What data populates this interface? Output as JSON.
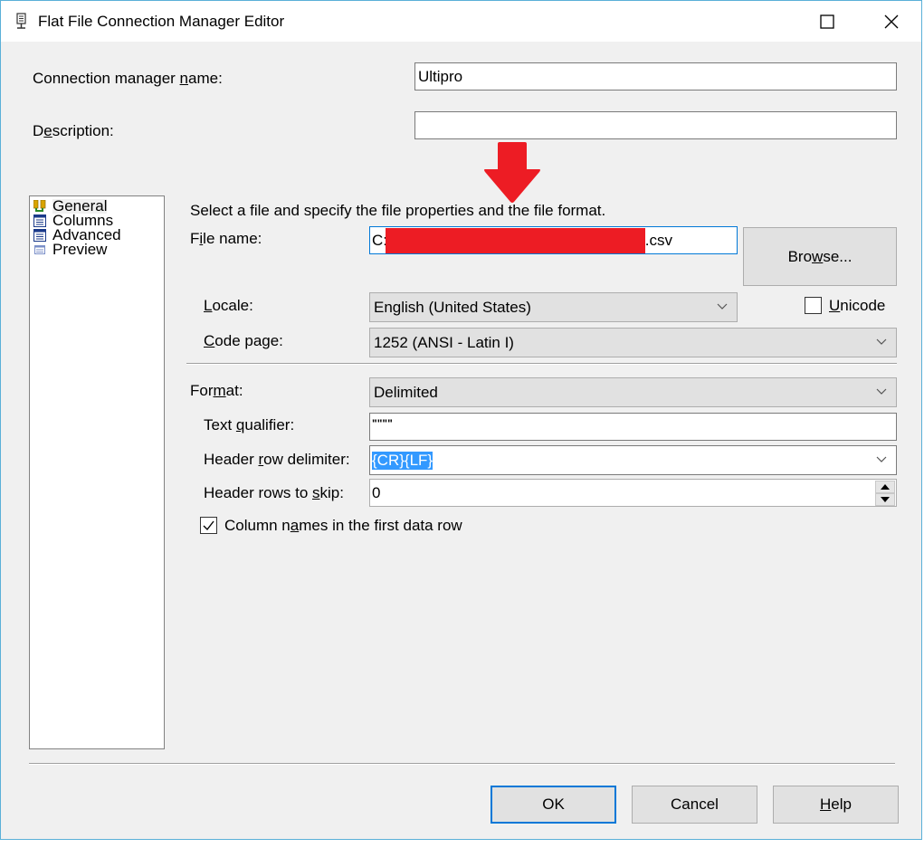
{
  "window": {
    "title": "Flat File Connection Manager Editor",
    "icon": "flat-file-connection-icon",
    "controls": [
      "maximize-icon",
      "close-icon"
    ]
  },
  "connection_manager_name": {
    "label_pre": "Connection manager ",
    "label_u": "n",
    "label_post": "ame:",
    "value": "Ultipro"
  },
  "description": {
    "label_pre": "D",
    "label_u": "e",
    "label_post": "scription:",
    "value": ""
  },
  "nav": {
    "items": [
      {
        "label": "General",
        "icon": "general-icon",
        "selected": true
      },
      {
        "label": "Columns",
        "icon": "columns-icon"
      },
      {
        "label": "Advanced",
        "icon": "advanced-icon"
      },
      {
        "label": "Preview",
        "icon": "preview-icon"
      }
    ]
  },
  "annotation": {
    "icon": "red-arrow-down-icon",
    "color": "#ed1c24"
  },
  "general": {
    "instruction": "Select a file and specify the file properties and the file format.",
    "file_name": {
      "label_pre": "F",
      "label_u": "i",
      "label_post": "le name:",
      "value_prefix": "C:\\",
      "value_suffix": ".csv",
      "redacted": true
    },
    "browse_button": {
      "pre": "Bro",
      "u": "w",
      "post": "se..."
    },
    "locale": {
      "label_u": "L",
      "label_post": "ocale:",
      "value": "English (United States)"
    },
    "unicode": {
      "label_u": "U",
      "label_post": "nicode",
      "checked": false
    },
    "code_page": {
      "label_u": "C",
      "label_post": "ode page:",
      "value": "1252  (ANSI - Latin I)"
    },
    "format": {
      "label_pre": "For",
      "label_u": "m",
      "label_post": "at:",
      "value": "Delimited"
    },
    "text_qualifier": {
      "label_pre": "Text ",
      "label_u": "q",
      "label_post": "ualifier:",
      "value": "\"\"\"\""
    },
    "header_row_delimiter": {
      "label_pre": "Header ",
      "label_u": "r",
      "label_post": "ow delimiter:",
      "value": "{CR}{LF}"
    },
    "header_rows_to_skip": {
      "label_pre": "Header rows to ",
      "label_u": "s",
      "label_post": "kip:",
      "value": "0"
    },
    "column_names_first_row": {
      "label_pre": "Column n",
      "label_u": "a",
      "label_post": "mes in the first data row",
      "checked": true
    }
  },
  "footer": {
    "ok": "OK",
    "cancel": "Cancel",
    "help_u": "H",
    "help_post": "elp"
  },
  "colors": {
    "window_border": "#5ab0d8",
    "default_button_border": "#0078d7",
    "selection": "#3399ff",
    "redaction": "#ed1c24"
  }
}
